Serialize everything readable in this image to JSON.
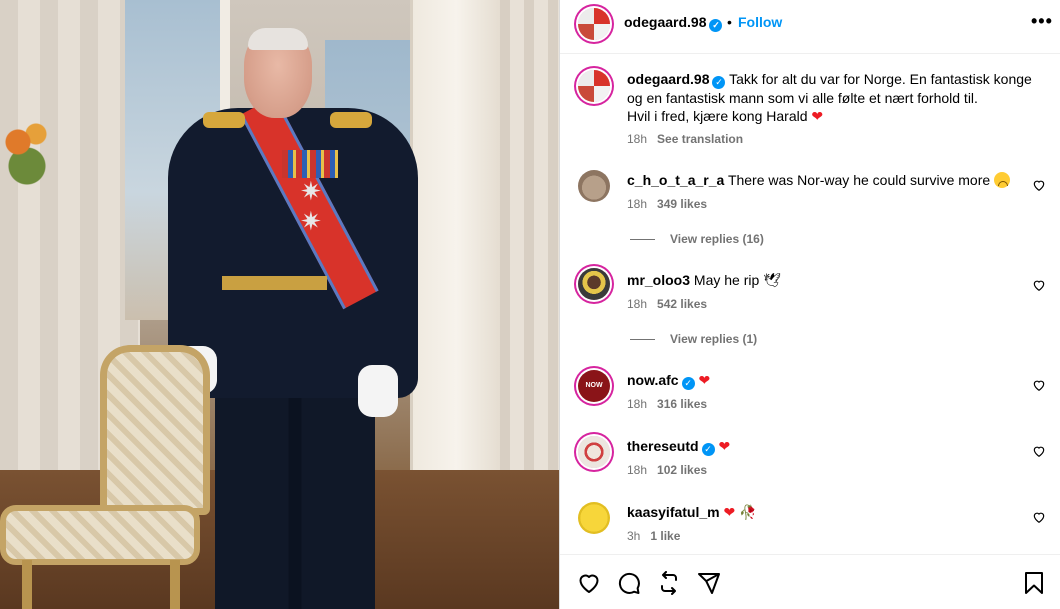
{
  "post": {
    "author": "odegaard.98",
    "follow_label": "Follow",
    "dot": "•",
    "more_label": "•••"
  },
  "caption": {
    "username": "odegaard.98",
    "line1": "Takk for alt du var for Norge. En fantastisk konge",
    "line2": "og en fantastisk mann som vi alle følte et nært forhold til.",
    "line3": "Hvil i fred, kjære kong Harald",
    "emoji": "❤",
    "time": "18h",
    "translate": "See translation"
  },
  "comments": [
    {
      "username": "c_h_o_t_a_r_a",
      "text": "There was Nor-way he could survive more",
      "emoji": "sad-face",
      "time": "18h",
      "likes": "349 likes",
      "replies": "View replies (16)"
    },
    {
      "username": "mr_oloo3",
      "text": "May he rip",
      "emoji": "🕊",
      "time": "18h",
      "likes": "542 likes",
      "replies": "View replies (1)"
    },
    {
      "username": "now.afc",
      "text": "",
      "emoji": "❤",
      "time": "18h",
      "likes": "316 likes",
      "avatar_text": "NOW"
    },
    {
      "username": "thereseutd",
      "text": "",
      "emoji": "❤",
      "time": "18h",
      "likes": "102 likes"
    },
    {
      "username": "kaasyifatul_m",
      "text": "",
      "emoji": "❤",
      "emoji2": "🥀",
      "time": "3h",
      "likes": "1 like"
    }
  ],
  "colors": {
    "accent": "#0095f6",
    "heart": "#ed1c24",
    "muted": "#737373"
  },
  "icons": [
    "heart-icon",
    "comment-icon",
    "repost-icon",
    "share-icon",
    "bookmark-icon",
    "verified-icon"
  ]
}
